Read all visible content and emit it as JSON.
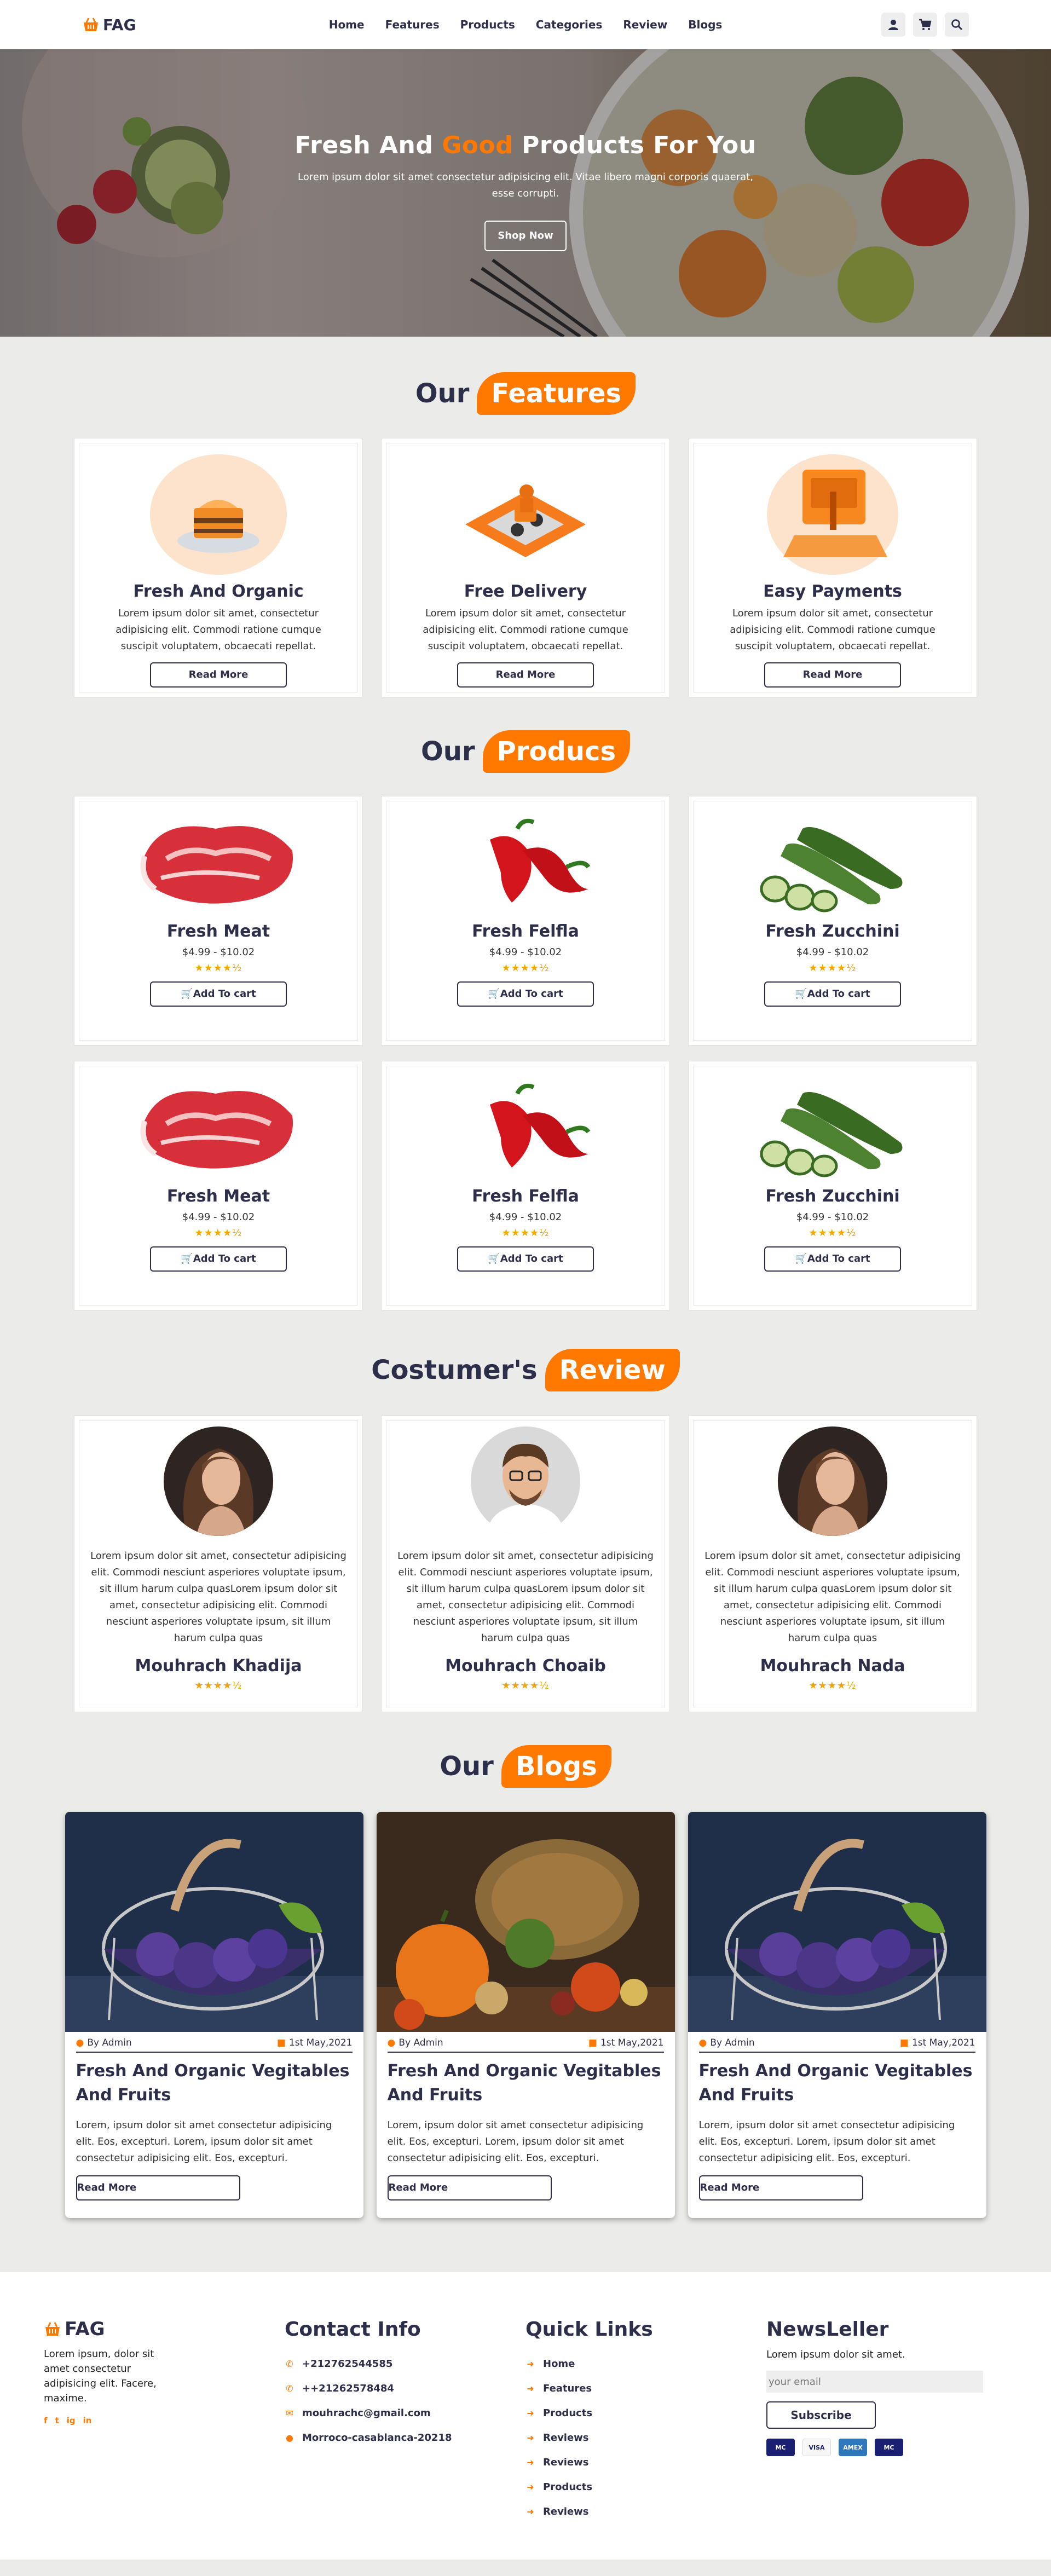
{
  "brand": {
    "name": "FAG",
    "accent": "#ff7800",
    "dark": "#2c2e4a"
  },
  "nav": {
    "items": [
      "Home",
      "Features",
      "Products",
      "Categories",
      "Review",
      "Blogs"
    ]
  },
  "header_icons": [
    "user-icon",
    "cart-icon",
    "search-icon"
  ],
  "hero": {
    "title_before": "Fresh And ",
    "title_accent": "Good",
    "title_after": " Products For You",
    "text": "Lorem ipsum dolor sit amet consectetur adipisicing elit. Vitae libero magni corporis quaerat, esse corrupti.",
    "button": "Shop Now"
  },
  "features": {
    "heading_plain": "Our",
    "heading_accent": "Features",
    "items": [
      {
        "title": "Fresh And Organic",
        "text": "Lorem ipsum dolor sit amet, consectetur adipisicing elit. Commodi ratione cumque suscipit voluptatem, obcaecati repellat.",
        "button": "Read More",
        "icon": "cake-icon"
      },
      {
        "title": "Free Delivery",
        "text": "Lorem ipsum dolor sit amet, consectetur adipisicing elit. Commodi ratione cumque suscipit voluptatem, obcaecati repellat.",
        "button": "Read More",
        "icon": "delivery-scooter-icon"
      },
      {
        "title": "Easy Payments",
        "text": "Lorem ipsum dolor sit amet, consectetur adipisicing elit. Commodi ratione cumque suscipit voluptatem, obcaecati repellat.",
        "button": "Read More",
        "icon": "card-payment-icon"
      }
    ]
  },
  "products": {
    "heading_plain": "Our",
    "heading_accent": "Producs",
    "rating": "★★★★½",
    "items": [
      {
        "name": "Fresh Meat",
        "price": "$4.99 - $10.02",
        "button": "Add To cart",
        "image": "meat"
      },
      {
        "name": "Fresh Felfla",
        "price": "$4.99 - $10.02",
        "button": "Add To cart",
        "image": "pepper"
      },
      {
        "name": "Fresh Zucchini",
        "price": "$4.99 - $10.02",
        "button": "Add To cart",
        "image": "zucchini"
      },
      {
        "name": "Fresh Meat",
        "price": "$4.99 - $10.02",
        "button": "Add To cart",
        "image": "meat"
      },
      {
        "name": "Fresh Felfla",
        "price": "$4.99 - $10.02",
        "button": "Add To cart",
        "image": "pepper"
      },
      {
        "name": "Fresh Zucchini",
        "price": "$4.99 - $10.02",
        "button": "Add To cart",
        "image": "zucchini"
      }
    ]
  },
  "review": {
    "heading_plain": "Costumer's",
    "heading_accent": "Review",
    "rating": "★★★★½",
    "items": [
      {
        "name": "Mouhrach Khadija",
        "text": "Lorem ipsum dolor sit amet, consectetur adipisicing elit. Commodi nesciunt asperiores voluptate ipsum, sit illum harum culpa quasLorem ipsum dolor sit amet, consectetur adipisicing elit. Commodi nesciunt asperiores voluptate ipsum, sit illum harum culpa quas",
        "avatar": "woman"
      },
      {
        "name": "Mouhrach Choaib",
        "text": "Lorem ipsum dolor sit amet, consectetur adipisicing elit. Commodi nesciunt asperiores voluptate ipsum, sit illum harum culpa quasLorem ipsum dolor sit amet, consectetur adipisicing elit. Commodi nesciunt asperiores voluptate ipsum, sit illum harum culpa quas",
        "avatar": "man"
      },
      {
        "name": "Mouhrach Nada",
        "text": "Lorem ipsum dolor sit amet, consectetur adipisicing elit. Commodi nesciunt asperiores voluptate ipsum, sit illum harum culpa quasLorem ipsum dolor sit amet, consectetur adipisicing elit. Commodi nesciunt asperiores voluptate ipsum, sit illum harum culpa quas",
        "avatar": "woman"
      }
    ]
  },
  "blogs": {
    "heading_plain": "Our",
    "heading_accent": "Blogs",
    "items": [
      {
        "author": "By Admin",
        "date": "1st May,2021",
        "title": "Fresh And Organic Vegitables And Fruits",
        "text": "Lorem, ipsum dolor sit amet consectetur adipisicing elit. Eos, excepturi. Lorem, ipsum dolor sit amet consectetur adipisicing elit. Eos, excepturi.",
        "button": "Read More",
        "image": "basket"
      },
      {
        "author": "By Admin",
        "date": "1st May,2021",
        "title": "Fresh And Organic Vegitables And Fruits",
        "text": "Lorem, ipsum dolor sit amet consectetur adipisicing elit. Eos, excepturi. Lorem, ipsum dolor sit amet consectetur adipisicing elit. Eos, excepturi.",
        "button": "Read More",
        "image": "harvest"
      },
      {
        "author": "By Admin",
        "date": "1st May,2021",
        "title": "Fresh And Organic Vegitables And Fruits",
        "text": "Lorem, ipsum dolor sit amet consectetur adipisicing elit. Eos, excepturi. Lorem, ipsum dolor sit amet consectetur adipisicing elit. Eos, excepturi.",
        "button": "Read More",
        "image": "basket"
      }
    ]
  },
  "footer": {
    "brand_text": "Lorem ipsum, dolor sit amet consectetur adipisicing elit. Facere, maxime.",
    "social": [
      "f",
      "t",
      "ig",
      "in"
    ],
    "contact": {
      "title": "Contact Info",
      "items": [
        {
          "icon": "phone-icon",
          "text": "+212762544585"
        },
        {
          "icon": "phone-icon",
          "text": "++21262578484"
        },
        {
          "icon": "envelope-icon",
          "text": "mouhrachc@gmail.com"
        },
        {
          "icon": "map-pin-icon",
          "text": "Morroco-casablanca-20218"
        }
      ]
    },
    "links": {
      "title": "Quick Links",
      "items": [
        "Home",
        "Features",
        "Products",
        "Reviews",
        "Reviews",
        "Products",
        "Reviews"
      ]
    },
    "news": {
      "title": "NewsLeller",
      "text": "Lorem ipsum dolor sit amet.",
      "placeholder": "your email",
      "button": "Subscribe",
      "cards": [
        "MC",
        "VISA",
        "AMEX",
        "MC"
      ]
    }
  }
}
